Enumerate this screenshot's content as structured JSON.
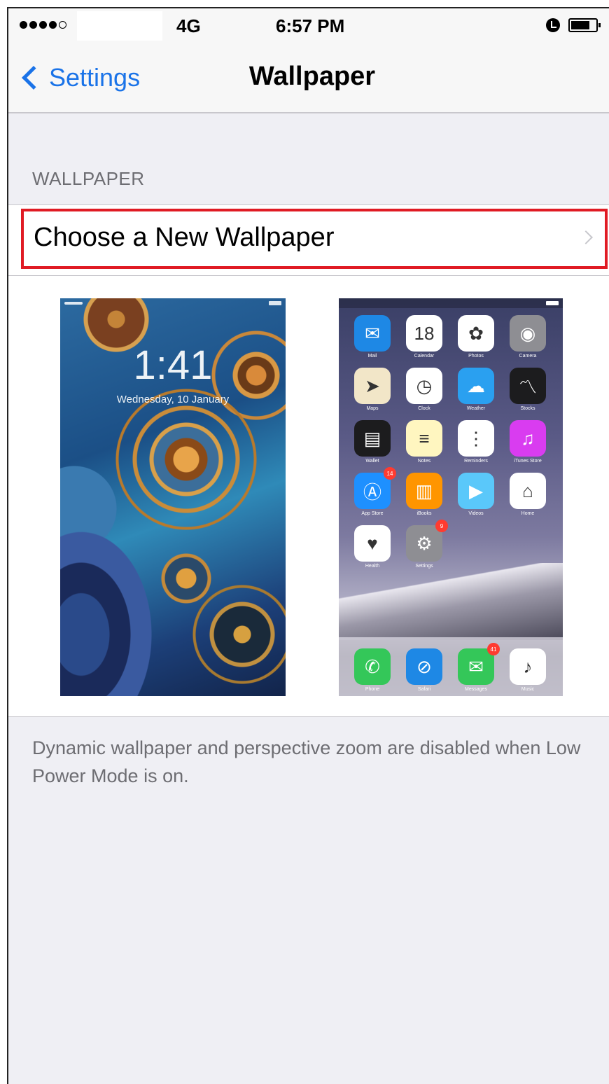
{
  "status_bar": {
    "network": "4G",
    "time": "6:57 PM",
    "signal_bars_filled": 4,
    "signal_bars_total": 5,
    "icons": [
      "signal-dots-icon",
      "alarm-icon",
      "battery-icon"
    ]
  },
  "nav": {
    "back_label": "Settings",
    "title": "Wallpaper"
  },
  "section": {
    "header": "WALLPAPER",
    "cell_label": "Choose a New Wallpaper",
    "highlight_color": "#e01b24"
  },
  "lock_preview": {
    "time": "1:41",
    "date": "Wednesday, 10 January"
  },
  "home_preview": {
    "apps": [
      {
        "name": "Mail",
        "icon": "mail-icon",
        "color": "#1e88e5",
        "glyph": "✉"
      },
      {
        "name": "Calendar",
        "icon": "calendar-icon",
        "color": "#ffffff",
        "glyph": "18"
      },
      {
        "name": "Photos",
        "icon": "photos-icon",
        "color": "#ffffff",
        "glyph": "✿"
      },
      {
        "name": "Camera",
        "icon": "camera-icon",
        "color": "#8e8e93",
        "glyph": "◉"
      },
      {
        "name": "Maps",
        "icon": "maps-icon",
        "color": "#f2e6c8",
        "glyph": "➤"
      },
      {
        "name": "Clock",
        "icon": "clock-icon",
        "color": "#ffffff",
        "glyph": "◷"
      },
      {
        "name": "Weather",
        "icon": "weather-icon",
        "color": "#2aa0f0",
        "glyph": "☁"
      },
      {
        "name": "Stocks",
        "icon": "stocks-icon",
        "color": "#1c1c1e",
        "glyph": "〽"
      },
      {
        "name": "Wallet",
        "icon": "wallet-icon",
        "color": "#1c1c1e",
        "glyph": "▤"
      },
      {
        "name": "Notes",
        "icon": "notes-icon",
        "color": "#fff6c0",
        "glyph": "≡"
      },
      {
        "name": "Reminders",
        "icon": "reminders-icon",
        "color": "#ffffff",
        "glyph": "⋮"
      },
      {
        "name": "iTunes Store",
        "icon": "itunes-store-icon",
        "color": "#d93cf0",
        "glyph": "♫"
      },
      {
        "name": "App Store",
        "icon": "app-store-icon",
        "color": "#1e90ff",
        "glyph": "Ⓐ",
        "badge": "14"
      },
      {
        "name": "iBooks",
        "icon": "ibooks-icon",
        "color": "#ff9500",
        "glyph": "▥"
      },
      {
        "name": "Videos",
        "icon": "videos-icon",
        "color": "#5ac8fa",
        "glyph": "▶"
      },
      {
        "name": "Home",
        "icon": "home-app-icon",
        "color": "#ffffff",
        "glyph": "⌂"
      },
      {
        "name": "Health",
        "icon": "health-icon",
        "color": "#ffffff",
        "glyph": "♥"
      },
      {
        "name": "Settings",
        "icon": "settings-icon",
        "color": "#8e8e93",
        "glyph": "⚙",
        "badge": "9"
      }
    ],
    "dock": [
      {
        "name": "Phone",
        "icon": "phone-icon",
        "color": "#34c759",
        "glyph": "✆"
      },
      {
        "name": "Safari",
        "icon": "safari-icon",
        "color": "#1e88e5",
        "glyph": "⊘"
      },
      {
        "name": "Messages",
        "icon": "messages-icon",
        "color": "#34c759",
        "glyph": "✉",
        "badge": "41"
      },
      {
        "name": "Music",
        "icon": "music-icon",
        "color": "#ffffff",
        "glyph": "♪"
      }
    ]
  },
  "footer_note": "Dynamic wallpaper and perspective zoom are disabled when Low Power Mode is on."
}
